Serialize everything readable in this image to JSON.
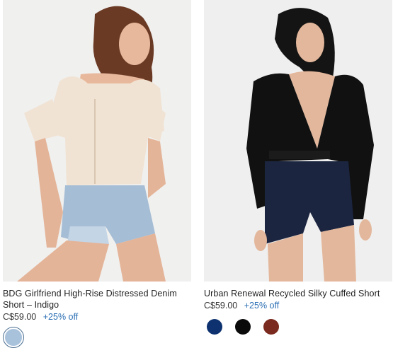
{
  "products": [
    {
      "title": "BDG Girlfriend High-Rise Distressed Denim Short – Indigo",
      "price": "C$59.00",
      "discount": "+25% off",
      "swatches": [
        {
          "name": "indigo",
          "color": "#a9c2dc"
        }
      ]
    },
    {
      "title": "Urban Renewal Recycled Silky Cuffed Short",
      "price": "C$59.00",
      "discount": "+25% off",
      "swatches": [
        {
          "name": "navy",
          "color": "#0e3270"
        },
        {
          "name": "black",
          "color": "#0a0a0a"
        },
        {
          "name": "burgundy",
          "color": "#7a2a1e"
        }
      ]
    }
  ]
}
